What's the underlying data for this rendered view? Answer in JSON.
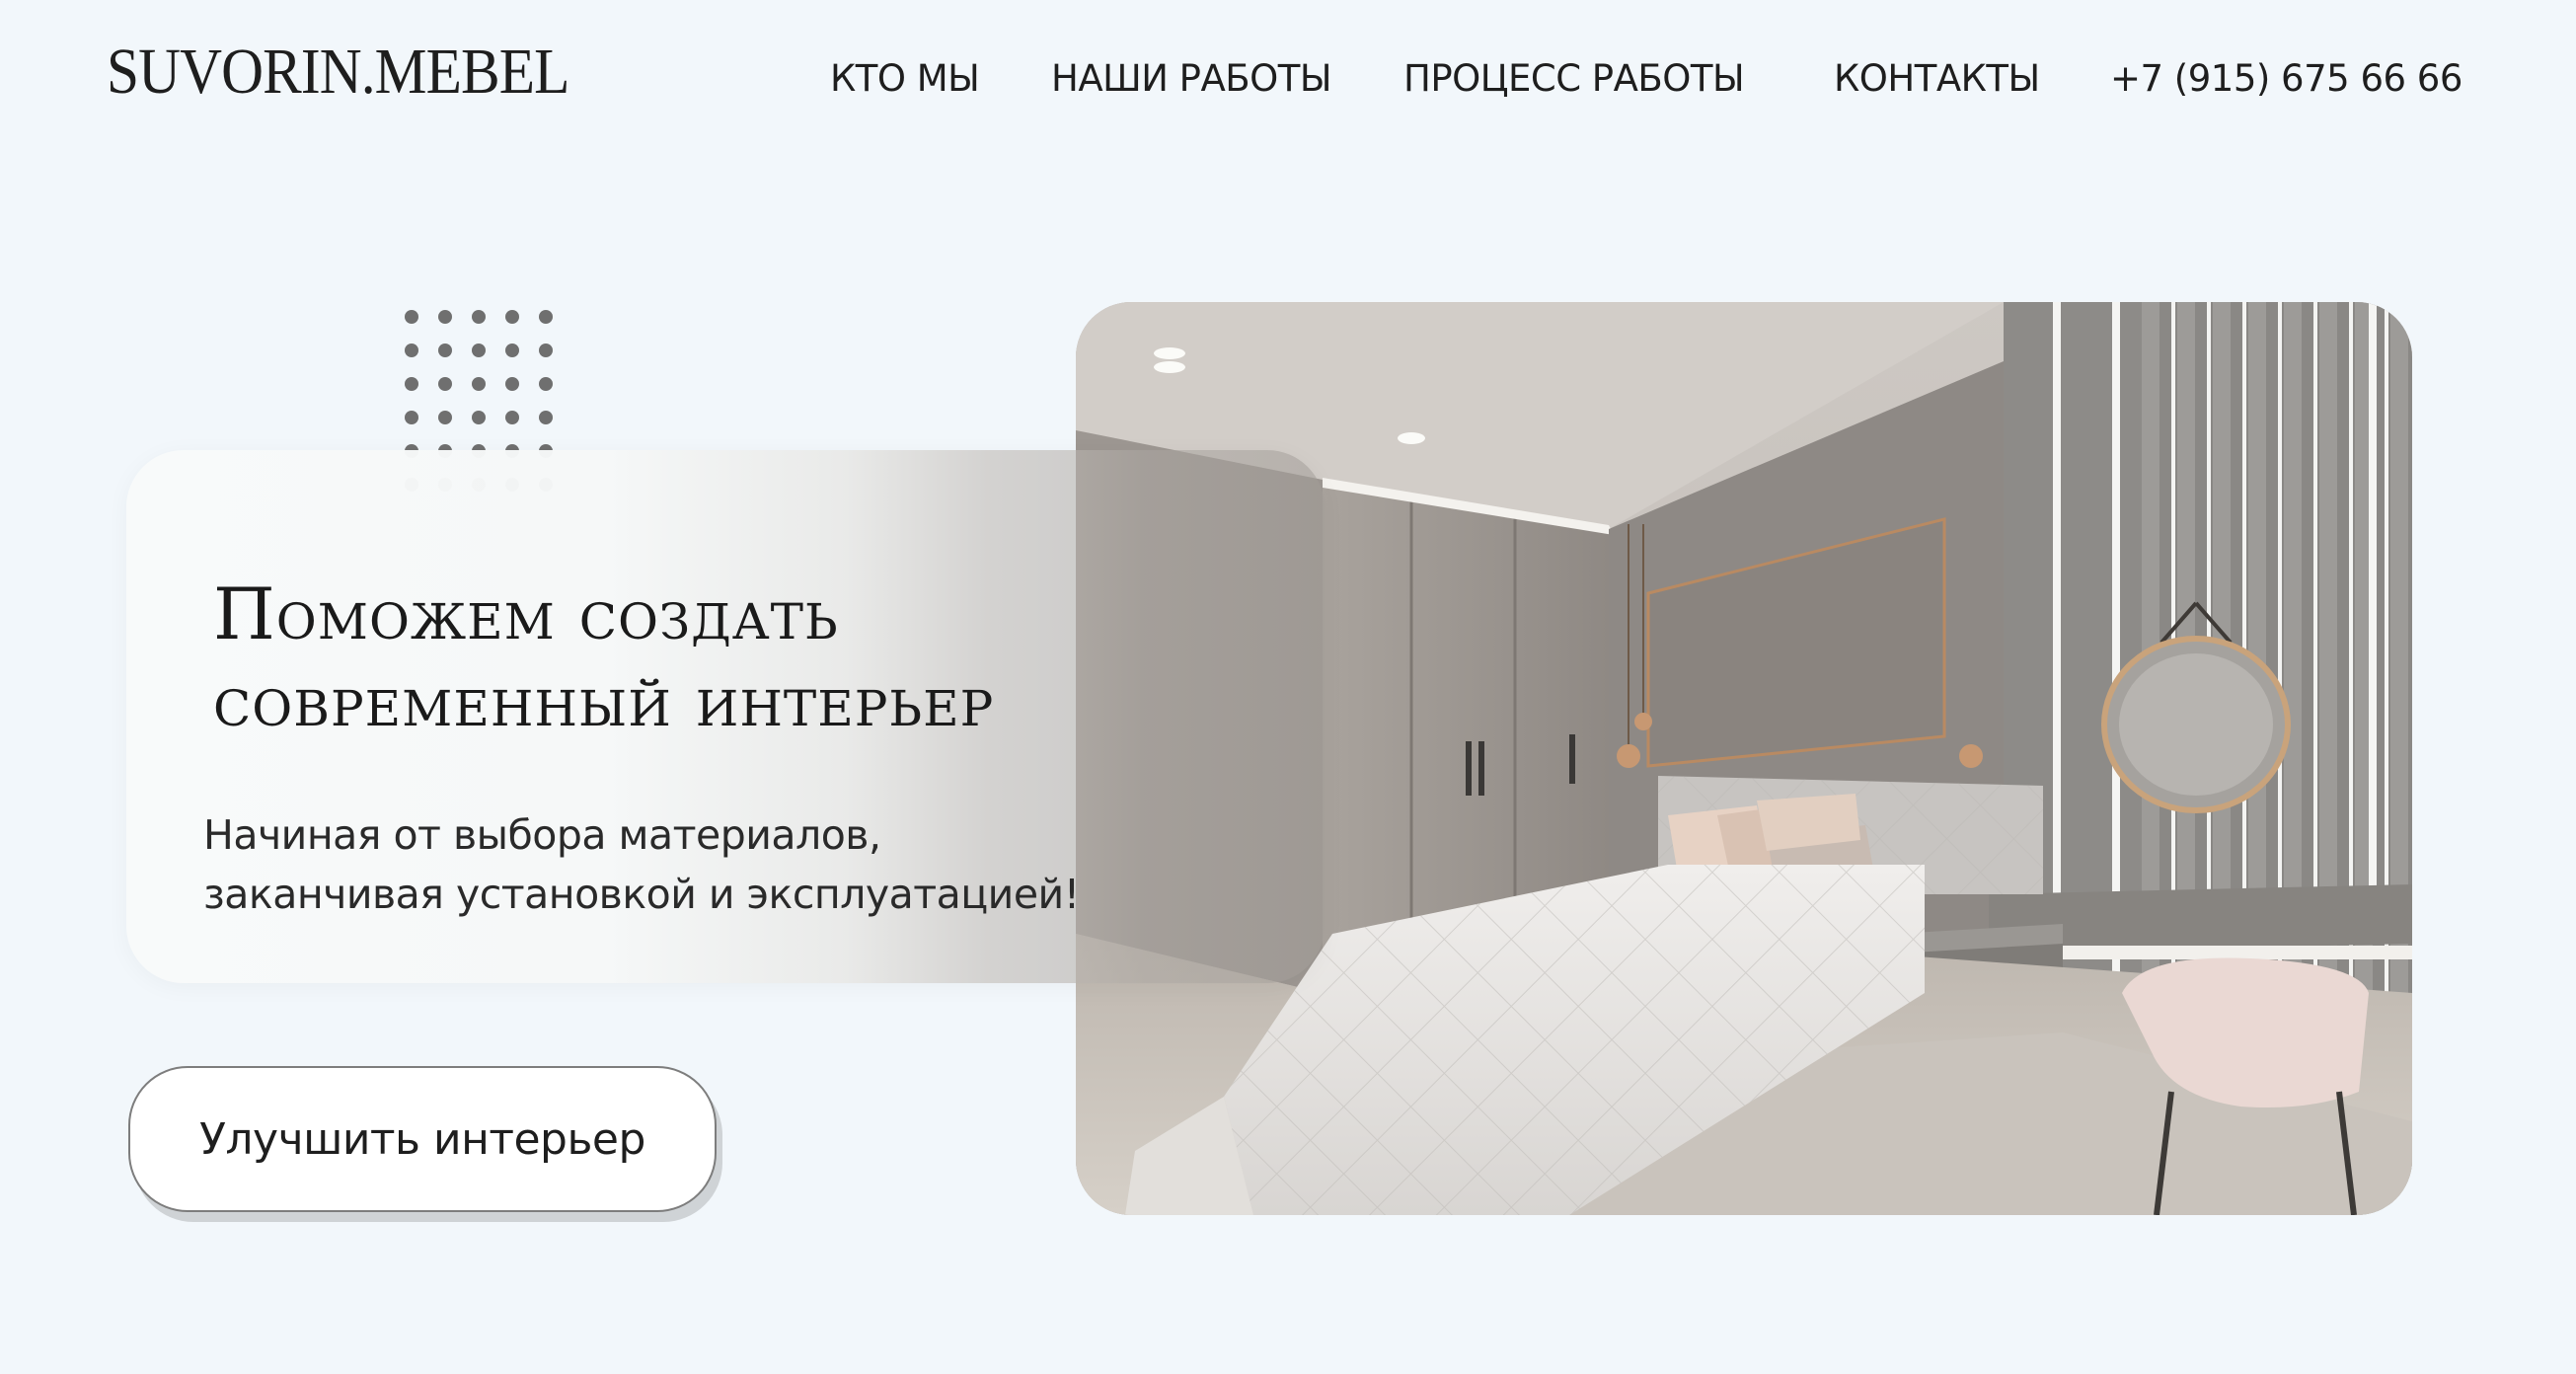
{
  "header": {
    "logo_text": "SUVORIN.MEBEL",
    "nav": {
      "who": "КТО МЫ",
      "works": "НАШИ РАБОТЫ",
      "process": "ПРОЦЕСС РАБОТЫ",
      "contacts": "КОНТАКТЫ",
      "phone": "+7 (915) 675 66 66"
    }
  },
  "hero": {
    "title_line1": "Поможем создать",
    "title_line2": "современный интерьер",
    "subtitle_line1": "Начиная от выбора материалов,",
    "subtitle_line2": "заканчивая установкой и эксплуатацией!",
    "cta_label": "Улучшить интерьер",
    "photo_icon": "bedroom-interior-photo"
  },
  "colors": {
    "background": "#f2f7fb",
    "text": "#1e1e1e",
    "dots": "#6f6f6f",
    "button_border": "#7d7d7d"
  }
}
